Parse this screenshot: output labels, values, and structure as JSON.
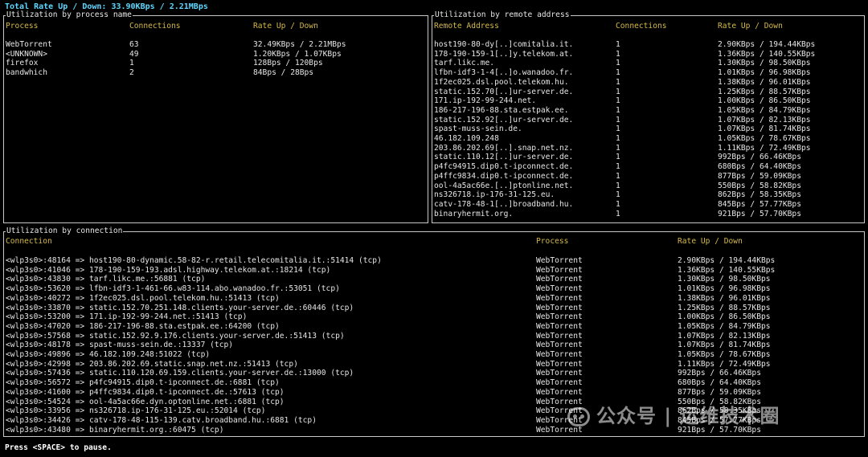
{
  "total": "Total Rate Up / Down: 33.90KBps / 2.21MBps",
  "process_panel": {
    "title": "Utilization by process name",
    "headers": [
      "Process",
      "Connections",
      "Rate Up / Down"
    ],
    "rows": [
      [
        "WebTorrent",
        "63",
        "32.49KBps / 2.21MBps"
      ],
      [
        "<UNKNOWN>",
        "49",
        "1.20KBps / 1.07KBps"
      ],
      [
        "firefox",
        "1",
        "128Bps / 120Bps"
      ],
      [
        "bandwhich",
        "2",
        "84Bps / 28Bps"
      ]
    ]
  },
  "remote_panel": {
    "title": "Utilization by remote address",
    "headers": [
      "Remote Address",
      "Connections",
      "Rate Up / Down"
    ],
    "rows": [
      [
        "host190-80-dy[..]comitalia.it.",
        "1",
        "2.90KBps / 194.44KBps"
      ],
      [
        "178-190-159-1[..]y.telekom.at.",
        "1",
        "1.36KBps / 140.55KBps"
      ],
      [
        "tarf.likc.me.",
        "1",
        "1.30KBps / 98.50KBps"
      ],
      [
        "lfbn-idf3-1-4[..]o.wanadoo.fr.",
        "1",
        "1.01KBps / 96.98KBps"
      ],
      [
        "1f2ec025.dsl.pool.telekom.hu.",
        "1",
        "1.38KBps / 96.01KBps"
      ],
      [
        "static.152.70[..]ur-server.de.",
        "1",
        "1.25KBps / 88.57KBps"
      ],
      [
        "171.ip-192-99-244.net.",
        "1",
        "1.00KBps / 86.50KBps"
      ],
      [
        "186-217-196-88.sta.estpak.ee.",
        "1",
        "1.05KBps / 84.79KBps"
      ],
      [
        "static.152.92[..]ur-server.de.",
        "1",
        "1.07KBps / 82.13KBps"
      ],
      [
        "spast-muss-sein.de.",
        "1",
        "1.07KBps / 81.74KBps"
      ],
      [
        "46.182.109.248",
        "1",
        "1.05KBps / 78.67KBps"
      ],
      [
        "203.86.202.69[..].snap.net.nz.",
        "1",
        "1.11KBps / 72.49KBps"
      ],
      [
        "static.110.12[..]ur-server.de.",
        "1",
        "992Bps / 66.46KBps"
      ],
      [
        "p4fc94915.dip0.t-ipconnect.de.",
        "1",
        "680Bps / 64.40KBps"
      ],
      [
        "p4ffc9834.dip0.t-ipconnect.de.",
        "1",
        "877Bps / 59.09KBps"
      ],
      [
        "ool-4a5ac66e.[..]ptonline.net.",
        "1",
        "550Bps / 58.82KBps"
      ],
      [
        "ns326718.ip-176-31-125.eu.",
        "1",
        "862Bps / 58.35KBps"
      ],
      [
        "catv-178-48-1[..]broadband.hu.",
        "1",
        "845Bps / 57.77KBps"
      ],
      [
        "binaryhermit.org.",
        "1",
        "921Bps / 57.70KBps"
      ]
    ]
  },
  "connection_panel": {
    "title": "Utilization by connection",
    "headers": [
      "Connection",
      "Process",
      "Rate Up / Down"
    ],
    "rows": [
      [
        "<wlp3s0>:48164 => host190-80-dynamic.58-82-r.retail.telecomitalia.it.:51414 (tcp)",
        "WebTorrent",
        "2.90KBps / 194.44KBps"
      ],
      [
        "<wlp3s0>:41046 => 178-190-159-193.adsl.highway.telekom.at.:18214 (tcp)",
        "WebTorrent",
        "1.36KBps / 140.55KBps"
      ],
      [
        "<wlp3s0>:43830 => tarf.likc.me.:56881 (tcp)",
        "WebTorrent",
        "1.30KBps / 98.50KBps"
      ],
      [
        "<wlp3s0>:53620 => lfbn-idf3-1-461-66.w83-114.abo.wanadoo.fr.:53051 (tcp)",
        "WebTorrent",
        "1.01KBps / 96.98KBps"
      ],
      [
        "<wlp3s0>:40272 => 1f2ec025.dsl.pool.telekom.hu.:51413 (tcp)",
        "WebTorrent",
        "1.38KBps / 96.01KBps"
      ],
      [
        "<wlp3s0>:33870 => static.152.70.251.148.clients.your-server.de.:60446 (tcp)",
        "WebTorrent",
        "1.25KBps / 88.57KBps"
      ],
      [
        "<wlp3s0>:53200 => 171.ip-192-99-244.net.:51413 (tcp)",
        "WebTorrent",
        "1.00KBps / 86.50KBps"
      ],
      [
        "<wlp3s0>:47020 => 186-217-196-88.sta.estpak.ee.:64200 (tcp)",
        "WebTorrent",
        "1.05KBps / 84.79KBps"
      ],
      [
        "<wlp3s0>:57568 => static.152.92.9.176.clients.your-server.de.:51413 (tcp)",
        "WebTorrent",
        "1.07KBps / 82.13KBps"
      ],
      [
        "<wlp3s0>:48178 => spast-muss-sein.de.:13337 (tcp)",
        "WebTorrent",
        "1.07KBps / 81.74KBps"
      ],
      [
        "<wlp3s0>:49896 => 46.182.109.248:51022 (tcp)",
        "WebTorrent",
        "1.05KBps / 78.67KBps"
      ],
      [
        "<wlp3s0>:42998 => 203.86.202.69.static.snap.net.nz.:51413 (tcp)",
        "WebTorrent",
        "1.11KBps / 72.49KBps"
      ],
      [
        "<wlp3s0>:57436 => static.110.120.69.159.clients.your-server.de.:13000 (tcp)",
        "WebTorrent",
        "992Bps / 66.46KBps"
      ],
      [
        "<wlp3s0>:56572 => p4fc94915.dip0.t-ipconnect.de.:6881 (tcp)",
        "WebTorrent",
        "680Bps / 64.40KBps"
      ],
      [
        "<wlp3s0>:41600 => p4ffc9834.dip0.t-ipconnect.de.:57613 (tcp)",
        "WebTorrent",
        "877Bps / 59.09KBps"
      ],
      [
        "<wlp3s0>:54524 => ool-4a5ac66e.dyn.optonline.net.:6881 (tcp)",
        "WebTorrent",
        "550Bps / 58.82KBps"
      ],
      [
        "<wlp3s0>:33956 => ns326718.ip-176-31-125.eu.:52014 (tcp)",
        "WebTorrent",
        "862Bps / 58.35KBps"
      ],
      [
        "<wlp3s0>:34426 => catv-178-48-115-139.catv.broadband.hu.:6881 (tcp)",
        "WebTorrent",
        "845Bps / 57.77KBps"
      ],
      [
        "<wlp3s0>:43480 => binaryhermit.org.:60475 (tcp)",
        "WebTorrent",
        "921Bps / 57.70KBps"
      ]
    ]
  },
  "footer": "Press <SPACE> to pause.",
  "watermark": "公众号 | 运维技术圈",
  "colors": {
    "background": "#000000",
    "header": "#d4b94a",
    "total": "#5fd7ff",
    "text": "#e6e6e6",
    "border": "#c8c8c8"
  }
}
